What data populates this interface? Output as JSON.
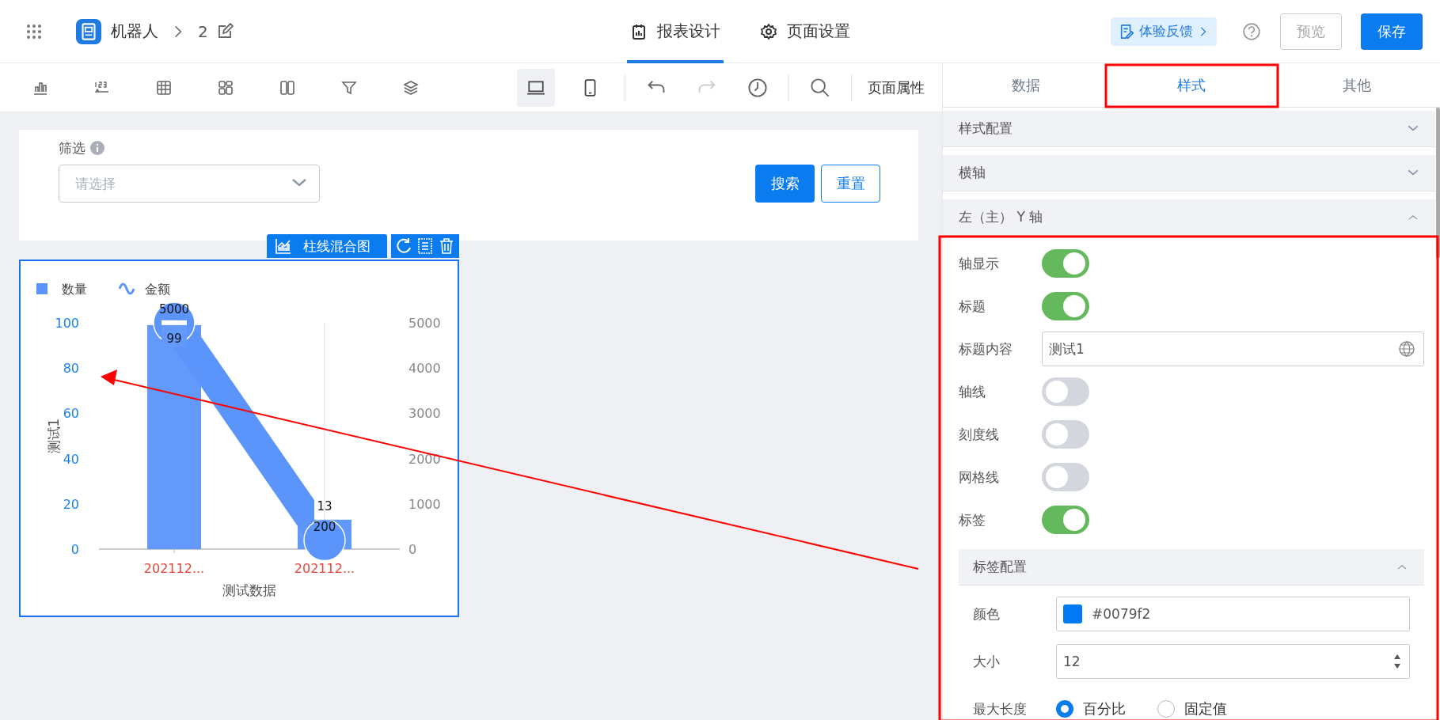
{
  "topbar": {
    "app_name": "机器人",
    "page_number": "2",
    "tabs": [
      {
        "label": "报表设计",
        "kind": "report",
        "selected": true
      },
      {
        "label": "页面设置",
        "kind": "settings",
        "selected": false
      }
    ],
    "feedback": "体验反馈",
    "buttons": [
      {
        "label": "预览",
        "kind": "secondary"
      },
      {
        "label": "保存",
        "kind": "primary"
      }
    ]
  },
  "toolbar": {
    "tools": [
      {
        "kind": "chart"
      },
      {
        "kind": "number"
      },
      {
        "kind": "table"
      },
      {
        "kind": "grid"
      },
      {
        "kind": "columns"
      },
      {
        "kind": "filter"
      },
      {
        "kind": "layers"
      }
    ],
    "devices": [
      {
        "kind": "desktop",
        "selected": true
      },
      {
        "kind": "mobile",
        "selected": false
      }
    ],
    "actions": [
      {
        "kind": "undo",
        "disabled": false
      },
      {
        "kind": "redo",
        "disabled": true
      },
      {
        "kind": "history",
        "disabled": false
      },
      {
        "kind": "search",
        "disabled": false
      }
    ],
    "page_properties": "页面属性"
  },
  "filter": {
    "label": "筛选",
    "select": {
      "placeholder": "请选择"
    },
    "buttons": [
      {
        "label": "搜索",
        "kind": "primary"
      },
      {
        "label": "重置",
        "kind": "secondary"
      }
    ]
  },
  "component": {
    "type_label": "柱线混合图",
    "bar_layer": {
      "chart_data": {
        "type": "bar",
        "xlabel": "测试数据",
        "ylabel": "测试1",
        "categories": [
          "202112...",
          "202112..."
        ],
        "series": [
          {
            "name": "数量",
            "color": "#5b94fb",
            "values": [
              99,
              13
            ]
          }
        ],
        "ylim": [
          0,
          100
        ],
        "yticks": [
          0,
          20,
          40,
          60,
          80,
          100
        ],
        "data_labels": true
      }
    },
    "line_layer": {
      "chart_data": {
        "type": "line",
        "series": [
          {
            "name": "金额",
            "color": "#5b94fb",
            "values": [
              5000,
              200
            ]
          }
        ],
        "ylim": [
          0,
          5000
        ],
        "yticks": [
          0,
          1000,
          2000,
          3000,
          4000,
          5000
        ],
        "data_labels": true
      }
    }
  },
  "panel": {
    "tabs": [
      {
        "label": "数据",
        "selected": false
      },
      {
        "label": "样式",
        "selected": true
      },
      {
        "label": "其他",
        "selected": false
      }
    ],
    "sections": [
      {
        "title": "样式配置",
        "expanded": false
      },
      {
        "title": "横轴",
        "expanded": false
      },
      {
        "title": "左（主） Y 轴",
        "expanded": true,
        "rows": [
          {
            "kind": "switch",
            "label": "轴显示",
            "on": true
          },
          {
            "kind": "switch",
            "label": "标题",
            "on": true
          },
          {
            "kind": "text",
            "label": "标题内容",
            "value": "测试1"
          },
          {
            "kind": "switch",
            "label": "轴线",
            "on": false
          },
          {
            "kind": "switch",
            "label": "刻度线",
            "on": false
          },
          {
            "kind": "switch",
            "label": "网格线",
            "on": false
          },
          {
            "kind": "switch",
            "label": "标签",
            "on": true
          },
          {
            "kind": "subsection",
            "title": "标签配置",
            "expanded": true,
            "rows": [
              {
                "kind": "color",
                "label": "颜色",
                "value": "#0079f2",
                "color": "#0079f2"
              },
              {
                "kind": "number",
                "label": "大小",
                "value": "12"
              },
              {
                "kind": "radio",
                "label": "最大长度",
                "options": [
                  {
                    "label": "百分比",
                    "selected": true
                  },
                  {
                    "label": "固定值",
                    "selected": false
                  }
                ]
              }
            ]
          }
        ]
      }
    ]
  },
  "annotations": [
    {
      "kind": "frame"
    },
    {
      "kind": "frame"
    },
    {
      "kind": "arrow"
    }
  ]
}
